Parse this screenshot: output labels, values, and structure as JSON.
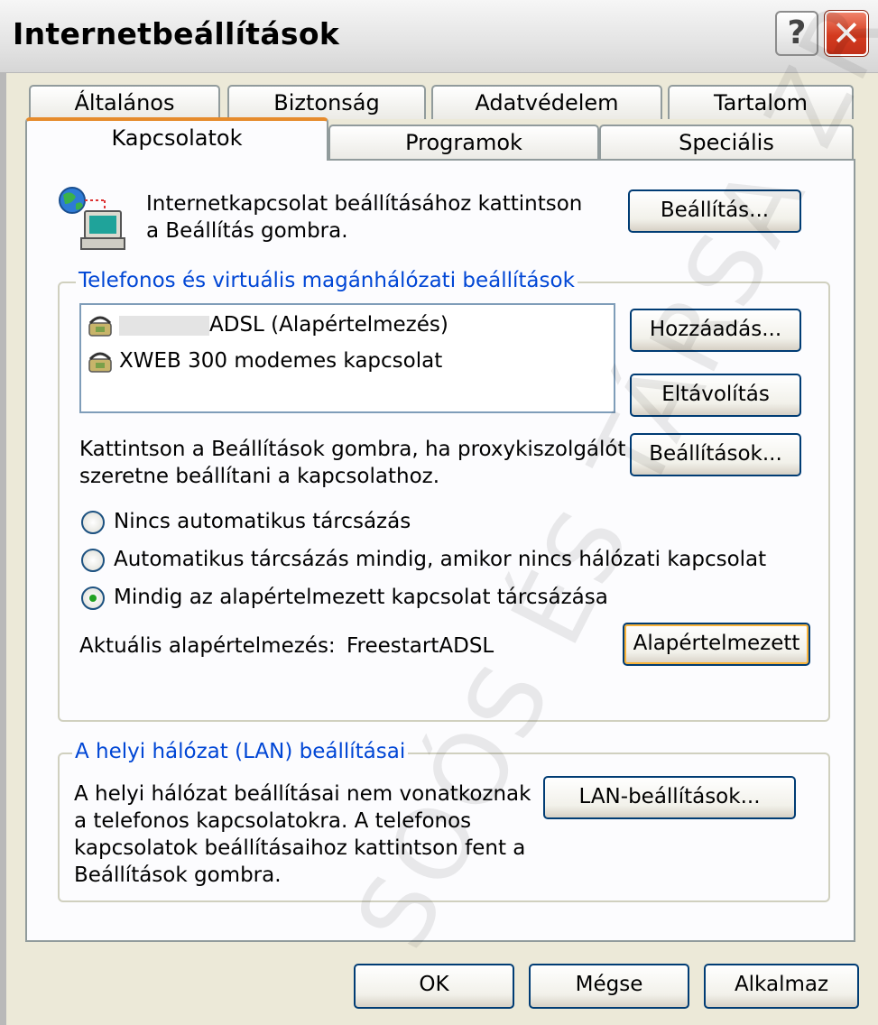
{
  "window": {
    "title": "Internetbeállítások",
    "help_label": "?",
    "close_label": "✕"
  },
  "tabs_row1": [
    "Általános",
    "Biztonság",
    "Adatvédelem",
    "Tartalom"
  ],
  "tabs_row2": [
    "Kapcsolatok",
    "Programok",
    "Speciális"
  ],
  "active_tab": "Kapcsolatok",
  "setup": {
    "text_line1": "Internetkapcsolat beállításához kattintson",
    "text_line2": "a Beállítás gombra.",
    "button": "Beállítás..."
  },
  "dialup": {
    "group_title": "Telefonos és virtuális magánhálózati beállítások",
    "connections": [
      "ADSL (Alapértelmezés)",
      "XWEB 300 modemes kapcsolat"
    ],
    "add_button": "Hozzáadás...",
    "remove_button": "Eltávolítás",
    "proxy_text_line1": "Kattintson a Beállítások gombra, ha proxykiszolgálót",
    "proxy_text_line2": "szeretne beállítani a kapcsolathoz.",
    "settings_button": "Beállítások...",
    "radio_options": [
      "Nincs automatikus tárcsázás",
      "Automatikus tárcsázás mindig, amikor nincs hálózati kapcsolat",
      "Mindig az alapértelmezett kapcsolat tárcsázása"
    ],
    "selected_option": 2,
    "current_default_label": "Aktuális alapértelmezés:",
    "current_default_value": "FreestartADSL",
    "set_default_button": "Alapértelmezett"
  },
  "lan": {
    "group_title": "A helyi hálózat (LAN) beállításai",
    "text_lines": [
      "A helyi hálózat beállításai nem vonatkoznak",
      "a telefonos kapcsolatokra. A telefonos",
      "kapcsolatok beállításaihoz kattintson fent a",
      "Beállítások gombra."
    ],
    "button": "LAN-beállítások..."
  },
  "footer": {
    "ok": "OK",
    "cancel": "Mégse",
    "apply": "Alkalmaz"
  },
  "watermark": "SOÓS ÉS TÁRSA ZR"
}
